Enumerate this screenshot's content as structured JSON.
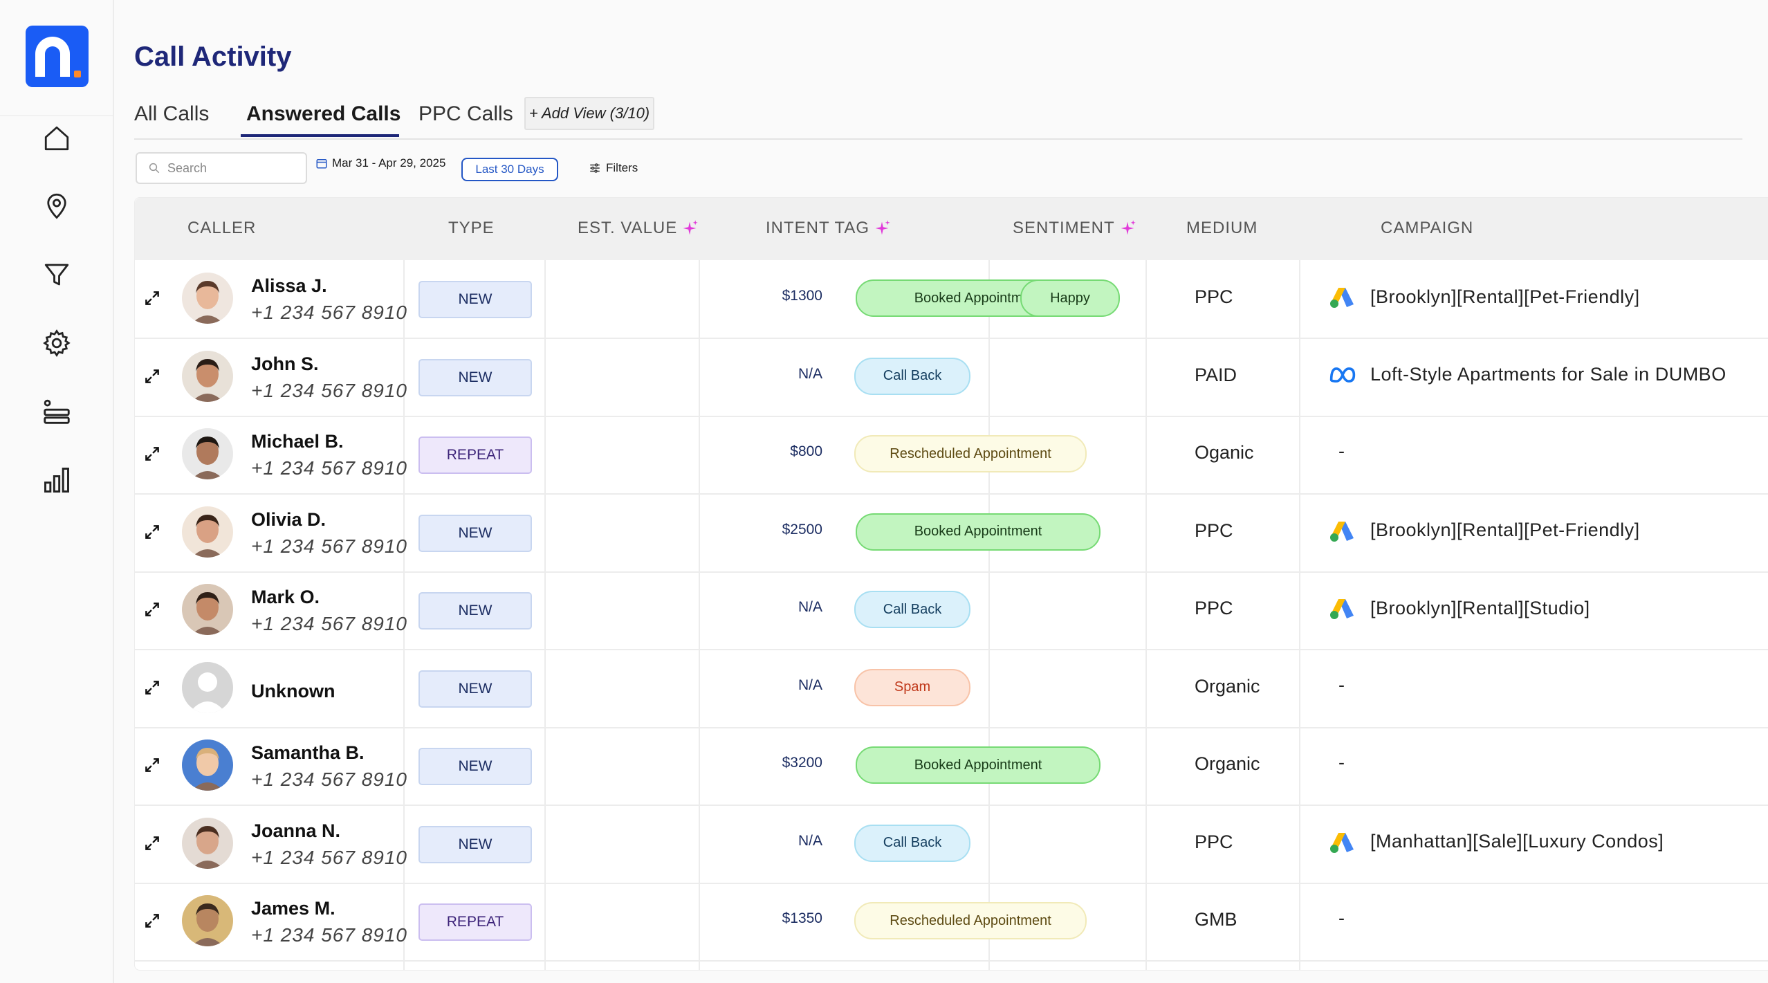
{
  "page": {
    "title": "Call Activity"
  },
  "tabs": [
    {
      "label": "All Calls"
    },
    {
      "label": "Answered Calls"
    },
    {
      "label": "PPC Calls"
    }
  ],
  "add_view": {
    "label": "+ Add View (3/10)"
  },
  "toolbar": {
    "search_placeholder": "Search",
    "date_range": "Mar 31 - Apr 29, 2025",
    "range_preset": "Last 30 Days",
    "filters_label": "Filters"
  },
  "table": {
    "headers": {
      "caller": "CALLER",
      "type": "TYPE",
      "est_value": "EST. VALUE",
      "intent_tag": "INTENT TAG",
      "sentiment": "SENTIMENT",
      "medium": "MEDIUM",
      "campaign": "CAMPAIGN"
    },
    "rows": [
      {
        "name": "Alissa J.",
        "phone": "+1 234 567 8910",
        "type": "NEW",
        "value": "$1300",
        "intent": "Booked Appointment",
        "sentiment": "Happy",
        "medium": "PPC",
        "campaign": "[Brooklyn][Rental][Pet-Friendly]",
        "campaign_icon": "google-ads-icon"
      },
      {
        "name": "John S.",
        "phone": "+1 234 567 8910",
        "type": "NEW",
        "value": "N/A",
        "intent": "Call Back",
        "sentiment": "",
        "medium": "PAID",
        "campaign": "Loft-Style Apartments for Sale in DUMBO",
        "campaign_icon": "meta-icon"
      },
      {
        "name": "Michael B.",
        "phone": "+1 234 567 8910",
        "type": "REPEAT",
        "value": "$800",
        "intent": "Rescheduled Appointment",
        "sentiment": "",
        "medium": "Oganic",
        "campaign": "-",
        "campaign_icon": ""
      },
      {
        "name": "Olivia D.",
        "phone": "+1 234 567 8910",
        "type": "NEW",
        "value": "$2500",
        "intent": "Booked Appointment",
        "sentiment": "",
        "medium": "PPC",
        "campaign": "[Brooklyn][Rental][Pet-Friendly]",
        "campaign_icon": "google-ads-icon"
      },
      {
        "name": "Mark O.",
        "phone": "+1 234 567 8910",
        "type": "NEW",
        "value": "N/A",
        "intent": "Call Back",
        "sentiment": "",
        "medium": "PPC",
        "campaign": "[Brooklyn][Rental][Studio]",
        "campaign_icon": "google-ads-icon"
      },
      {
        "name": "Unknown",
        "phone": "",
        "type": "NEW",
        "value": "N/A",
        "intent": "Spam",
        "sentiment": "",
        "medium": "Organic",
        "campaign": "-",
        "campaign_icon": ""
      },
      {
        "name": "Samantha B.",
        "phone": "+1 234 567 8910",
        "type": "NEW",
        "value": "$3200",
        "intent": "Booked Appointment",
        "sentiment": "",
        "medium": "Organic",
        "campaign": "-",
        "campaign_icon": ""
      },
      {
        "name": "Joanna N.",
        "phone": "+1 234 567 8910",
        "type": "NEW",
        "value": "N/A",
        "intent": "Call Back",
        "sentiment": "",
        "medium": "PPC",
        "campaign": "[Manhattan][Sale][Luxury Condos]",
        "campaign_icon": "google-ads-icon"
      },
      {
        "name": "James M.",
        "phone": "+1 234 567 8910",
        "type": "REPEAT",
        "value": "$1350",
        "intent": "Rescheduled Appointment",
        "sentiment": "",
        "medium": "GMB",
        "campaign": "-",
        "campaign_icon": ""
      }
    ]
  },
  "colors": {
    "brand_blue": "#1a5cf5",
    "title_navy": "#1e2778",
    "booked_green": "#c2f5c0",
    "callback_blue": "#dbf1fb",
    "rescheduled_yellow": "#fdfbe6",
    "spam_orange": "#fde4d8"
  }
}
